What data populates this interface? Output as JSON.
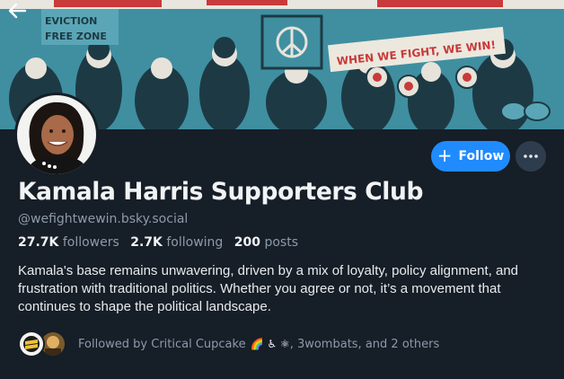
{
  "banner": {
    "sign_left": "EVICTION",
    "sign_left_2": "FREE ZONE",
    "sign_right": "WHEN WE FIGHT, WE WIN!"
  },
  "profile": {
    "display_name": "Kamala Harris Supporters Club",
    "handle": "@wefightwewin.bsky.social",
    "followers_count": "27.7K",
    "followers_label": "followers",
    "following_count": "2.7K",
    "following_label": "following",
    "posts_count": "200",
    "posts_label": "posts",
    "bio": "Kamala's base remains unwavering, driven by a mix of loyalty, policy alignment, and frustration with traditional politics. Whether you agree or not, it’s a movement that continues to shape the political landscape."
  },
  "actions": {
    "follow_label": "Follow"
  },
  "followed_by": {
    "prefix": "Followed by Critical Cupcake",
    "emojis": "🌈 ♿ ⚛",
    "suffix": ", 3wombats, and 2 others"
  },
  "icons": {
    "back": "arrow-left-icon",
    "follow": "plus-icon",
    "more": "ellipsis-icon"
  },
  "colors": {
    "background": "#161e27",
    "accent": "#208bfe",
    "muted_text": "#8d9aab",
    "banner_teal": "#3c8a9c"
  }
}
